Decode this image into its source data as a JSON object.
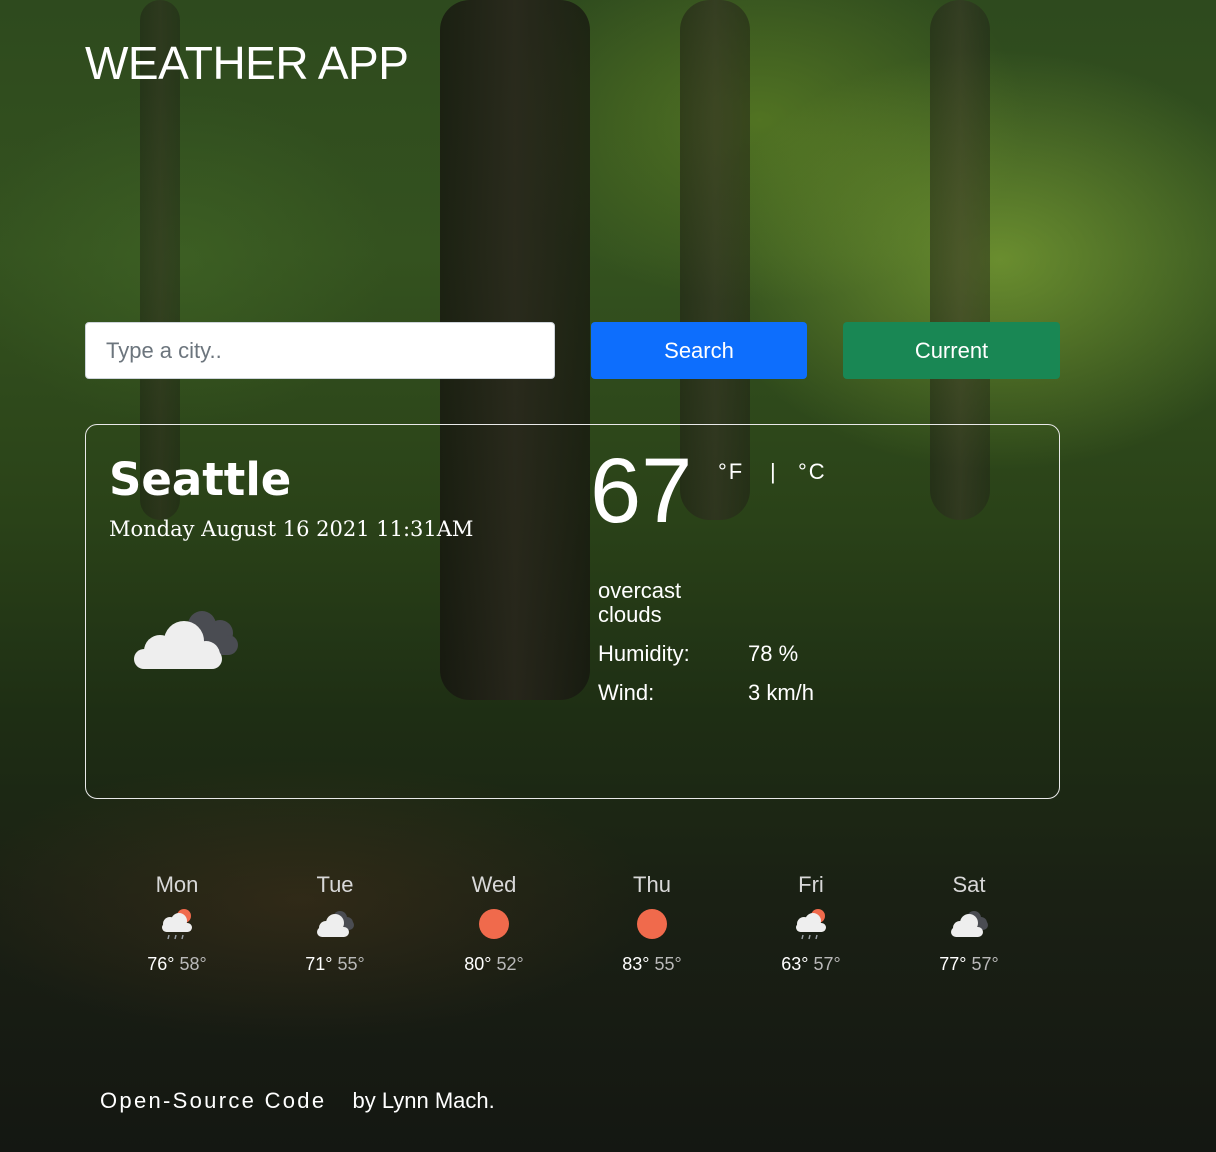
{
  "app": {
    "title": "WEATHER APP"
  },
  "search": {
    "placeholder": "Type a city..",
    "value": ""
  },
  "buttons": {
    "search_label": "Search",
    "current_label": "Current"
  },
  "current": {
    "city": "Seattle",
    "datetime": "Monday August 16 2021 11:31AM",
    "temperature": "67",
    "unit_f": "°F",
    "unit_separator": "|",
    "unit_c": "°C",
    "description": "overcast clouds",
    "humidity_label": "Humidity:",
    "humidity_value": "78 %",
    "wind_label": "Wind:",
    "wind_value": "3 km/h",
    "icon": "broken-clouds-icon"
  },
  "forecast": [
    {
      "day": "Mon",
      "max": "76°",
      "min": "58°",
      "icon": "rain-sun-icon"
    },
    {
      "day": "Tue",
      "max": "71°",
      "min": "55°",
      "icon": "broken-clouds-icon"
    },
    {
      "day": "Wed",
      "max": "80°",
      "min": "52°",
      "icon": "sun-icon"
    },
    {
      "day": "Thu",
      "max": "83°",
      "min": "55°",
      "icon": "sun-icon"
    },
    {
      "day": "Fri",
      "max": "63°",
      "min": "57°",
      "icon": "rain-sun-icon"
    },
    {
      "day": "Sat",
      "max": "77°",
      "min": "57°",
      "icon": "broken-clouds-icon"
    }
  ],
  "footer": {
    "link_text": "Open-Source Code",
    "credit": "by Lynn Mach."
  },
  "colors": {
    "search_button": "#0d6efd",
    "current_button": "#198754",
    "sun": "#f06a4c"
  }
}
